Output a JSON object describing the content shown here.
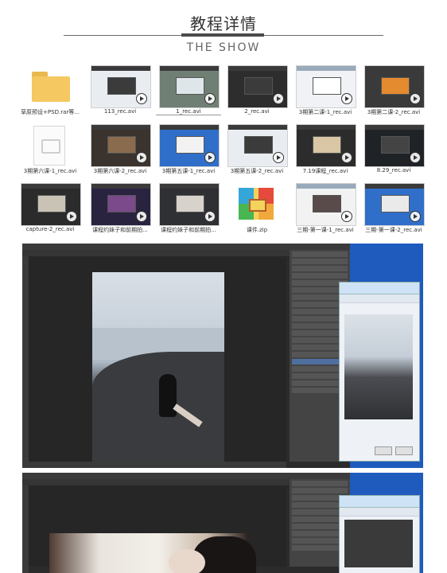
{
  "header": {
    "title": "教程详情",
    "subtitle": "THE SHOW"
  },
  "files": [
    {
      "name": "草原预设+PSD.rar等...",
      "kind": "folder",
      "icon": "folder-icon"
    },
    {
      "name": "113_rec.avi",
      "kind": "video",
      "icon": "video-thumbnail"
    },
    {
      "name": "1_rec.avi",
      "kind": "video",
      "icon": "video-thumbnail",
      "selected": true
    },
    {
      "name": "2_rec.avi",
      "kind": "video",
      "icon": "video-thumbnail"
    },
    {
      "name": "3期第二课-1_rec.avi",
      "kind": "video",
      "icon": "video-thumbnail"
    },
    {
      "name": "3期第二课-2_rec.avi",
      "kind": "video",
      "icon": "video-thumbnail"
    },
    {
      "name": "3期第六课-1_rec.avi",
      "kind": "doc",
      "icon": "video-file-icon"
    },
    {
      "name": "3期第六课-2_rec.avi",
      "kind": "video",
      "icon": "video-thumbnail"
    },
    {
      "name": "3期第五课-1_rec.avi",
      "kind": "video",
      "icon": "video-thumbnail"
    },
    {
      "name": "3期第五课-2_rec.avi",
      "kind": "video",
      "icon": "video-thumbnail"
    },
    {
      "name": "7.19课程_rec.avi",
      "kind": "video",
      "icon": "video-thumbnail"
    },
    {
      "name": "8.29_rec.avi",
      "kind": "video",
      "icon": "video-thumbnail"
    },
    {
      "name": "capture-2_rec.avi",
      "kind": "video",
      "icon": "video-thumbnail"
    },
    {
      "name": "课程约妹子和前期拍...",
      "kind": "video",
      "icon": "video-thumbnail"
    },
    {
      "name": "课程约妹子和前期拍...",
      "kind": "video",
      "icon": "video-thumbnail"
    },
    {
      "name": "课件.zip",
      "kind": "zip",
      "icon": "zip-archive-icon"
    },
    {
      "name": "三期-第一课-1_rec.avi",
      "kind": "video",
      "icon": "video-thumbnail"
    },
    {
      "name": "三期-第一课-2_rec.avi",
      "kind": "video",
      "icon": "video-thumbnail"
    }
  ],
  "colors": {
    "photoshop_bg": "#2b2b2b",
    "desktop_blue": "#1e5bbd",
    "folder": "#f5c862"
  }
}
